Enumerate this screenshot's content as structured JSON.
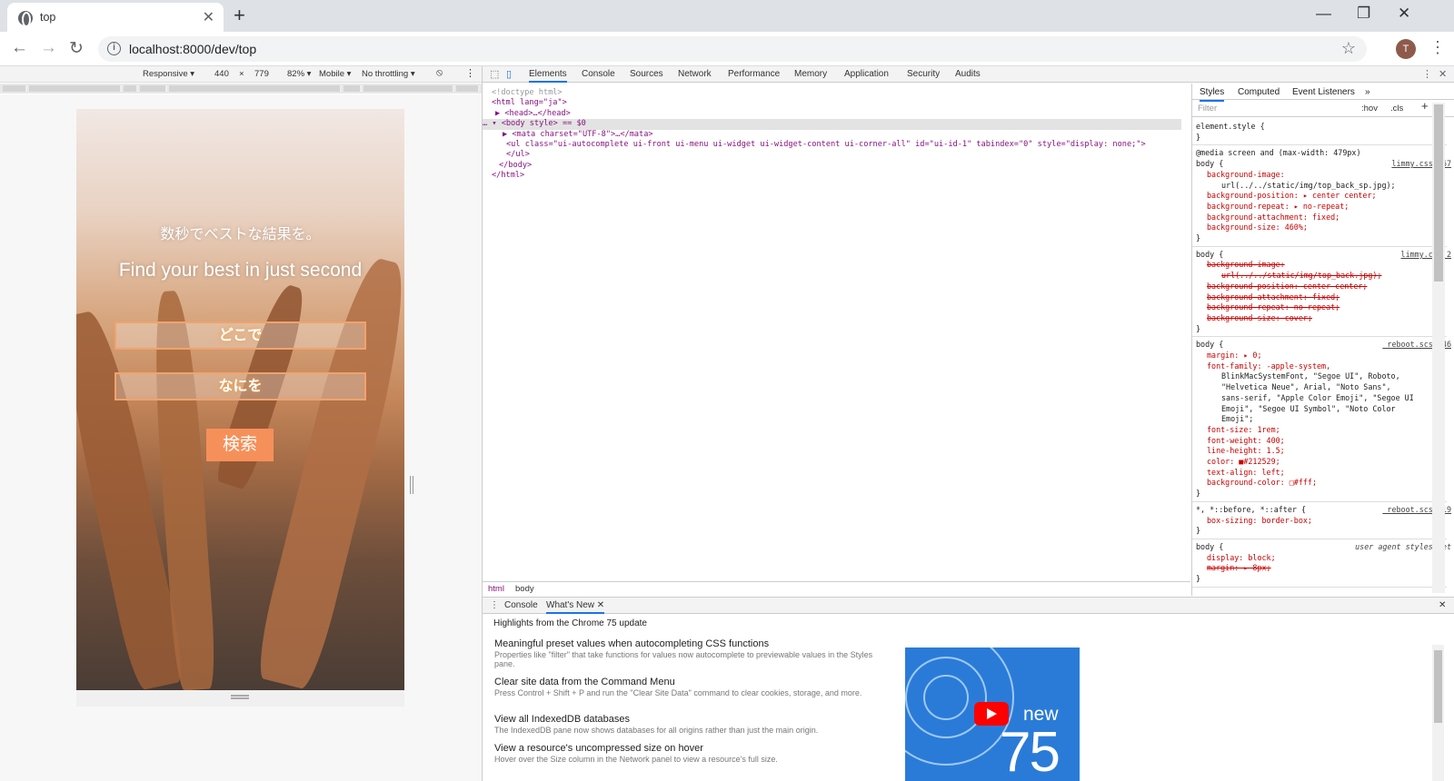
{
  "browser": {
    "tab_title": "top",
    "url": "localhost:8000/dev/top",
    "avatar_letter": "T",
    "minimize": "—",
    "maximize": "❐",
    "close": "✕"
  },
  "device_toolbar": {
    "mode": "Responsive ▾",
    "width": "440",
    "times": "×",
    "height": "779",
    "zoom": "82% ▾",
    "device_type": "Mobile ▾",
    "throttling": "No throttling ▾"
  },
  "page": {
    "tagline_ja": "数秒でベストな結果を。",
    "tagline_en": "Find your best in just second",
    "field_where": "どこで",
    "field_what": "なにを",
    "search_button": "検索"
  },
  "devtools": {
    "tabs": [
      "Elements",
      "Console",
      "Sources",
      "Network",
      "Performance",
      "Memory",
      "Application",
      "Security",
      "Audits"
    ],
    "elements_lines": [
      {
        "text": "<!doctype html>",
        "cls": "t-gray"
      },
      {
        "text": "<html lang=\"ja\">",
        "cls": "t-tag"
      },
      {
        "text": "▶ <head>…</head>",
        "cls": "t-tag"
      },
      {
        "text": "… ▾ <body style> == $0",
        "cls": "t-tag"
      },
      {
        "text": "▶ <mata charset=\"UTF-8\">…</mata>",
        "cls": "t-tag"
      },
      {
        "text": "<ul class=\"ui-autocomplete ui-front ui-menu ui-widget ui-widget-content ui-corner-all\" id=\"ui-id-1\" tabindex=\"0\" style=\"display: none;\">",
        "cls": "t-tag"
      },
      {
        "text": "</ul>",
        "cls": "t-tag"
      },
      {
        "text": "</body>",
        "cls": "t-tag"
      },
      {
        "text": "</html>",
        "cls": "t-tag"
      }
    ],
    "breadcrumbs": [
      "html",
      "body"
    ],
    "styles_tabs": [
      "Styles",
      "Computed",
      "Event Listeners",
      "»"
    ],
    "filter_placeholder": "Filter",
    "hov": ":hov",
    "cls": ".cls",
    "plus": "+",
    "style_lines": [
      {
        "text": "element.style {",
        "kind": "sel"
      },
      {
        "text": "}",
        "kind": "sel"
      },
      {
        "text": "@media screen and (max-width: 479px)",
        "kind": "sel"
      },
      {
        "text": "body {",
        "kind": "sel",
        "link": "limmy.css:167"
      },
      {
        "text": "background-image:",
        "kind": "prop"
      },
      {
        "text": "url(../../static/img/top_back_sp.jpg);",
        "kind": "val"
      },
      {
        "text": "background-position: ▸ center center;",
        "kind": "prop"
      },
      {
        "text": "background-repeat: ▸ no-repeat;",
        "kind": "prop"
      },
      {
        "text": "background-attachment: fixed;",
        "kind": "prop"
      },
      {
        "text": "background-size: 460%;",
        "kind": "prop"
      },
      {
        "text": "}",
        "kind": "sel"
      },
      {
        "text": "body {",
        "kind": "sel",
        "link": "limmy.css:2"
      },
      {
        "text": "background-image:",
        "kind": "strike"
      },
      {
        "text": "url(../../static/img/top_back.jpg);",
        "kind": "strike2"
      },
      {
        "text": "background-position: center center;",
        "kind": "strike"
      },
      {
        "text": "background-attachment: fixed;",
        "kind": "strike"
      },
      {
        "text": "background-repeat: no-repeat;",
        "kind": "strike"
      },
      {
        "text": "background-size: cover;",
        "kind": "strike"
      },
      {
        "text": "}",
        "kind": "sel"
      },
      {
        "text": "body {",
        "kind": "sel",
        "link": "_reboot.scss:46"
      },
      {
        "text": "margin: ▸ 0;",
        "kind": "prop"
      },
      {
        "text": "font-family: -apple-system,",
        "kind": "prop"
      },
      {
        "text": "BlinkMacSystemFont, \"Segoe UI\", Roboto,",
        "kind": "val"
      },
      {
        "text": "\"Helvetica Neue\", Arial, \"Noto Sans\",",
        "kind": "val"
      },
      {
        "text": "sans-serif, \"Apple Color Emoji\", \"Segoe UI",
        "kind": "val"
      },
      {
        "text": "Emoji\", \"Segoe UI Symbol\", \"Noto Color",
        "kind": "val"
      },
      {
        "text": "Emoji\";",
        "kind": "val"
      },
      {
        "text": "font-size: 1rem;",
        "kind": "prop"
      },
      {
        "text": "font-weight: 400;",
        "kind": "prop"
      },
      {
        "text": "line-height: 1.5;",
        "kind": "prop"
      },
      {
        "text": "color: ■#212529;",
        "kind": "prop"
      },
      {
        "text": "text-align: left;",
        "kind": "prop"
      },
      {
        "text": "background-color: □#fff;",
        "kind": "prop"
      },
      {
        "text": "}",
        "kind": "sel"
      },
      {
        "text": "*, *::before, *::after {",
        "kind": "sel",
        "link": "_reboot.scss:19"
      },
      {
        "text": "box-sizing: border-box;",
        "kind": "prop"
      },
      {
        "text": "}",
        "kind": "sel"
      },
      {
        "text": "body {",
        "kind": "sel",
        "agent": "user agent stylesheet"
      },
      {
        "text": "display: block;",
        "kind": "prop"
      },
      {
        "text": "margin: ▸ 8px;",
        "kind": "strike"
      },
      {
        "text": "}",
        "kind": "sel"
      }
    ]
  },
  "drawer": {
    "tabs": [
      "Console",
      "What's New ✕"
    ],
    "highlights": "Highlights from the Chrome 75 update",
    "items": [
      {
        "title": "Meaningful preset values when autocompleting CSS functions",
        "desc": "Properties like \"filter\" that take functions for values now autocomplete to previewable values in the Styles pane."
      },
      {
        "title": "Clear site data from the Command Menu",
        "desc": "Press Control + Shift + P and run the \"Clear Site Data\" command to clear cookies, storage, and more."
      },
      {
        "title": "View all IndexedDB databases",
        "desc": "The IndexedDB pane now shows databases for all origins rather than just the main origin."
      },
      {
        "title": "View a resource's uncompressed size on hover",
        "desc": "Hover over the Size column in the Network panel to view a resource's full size."
      }
    ],
    "promo_new": "new",
    "promo_version": "75"
  }
}
